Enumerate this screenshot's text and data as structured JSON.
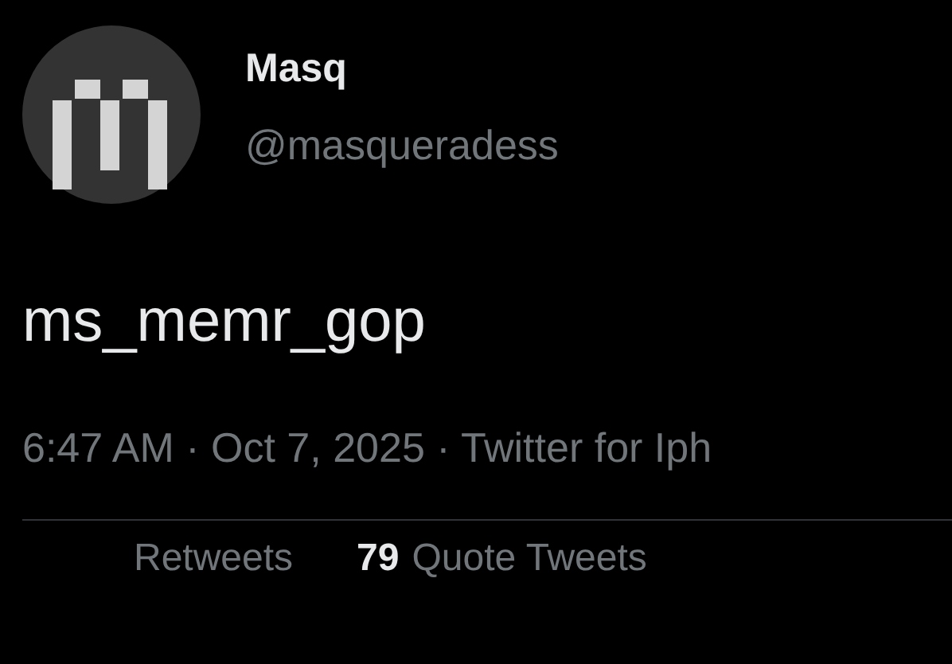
{
  "author": {
    "name": "Masq",
    "handle": "@masqueradess"
  },
  "tweet": {
    "text": "ms_memr_gop",
    "meta": "6:47 AM · Oct 7, 2025 · Twitter for Iph"
  },
  "stats": [
    {
      "label": "Retweets"
    },
    {
      "count": "79",
      "label": "Quote Tweets"
    }
  ]
}
